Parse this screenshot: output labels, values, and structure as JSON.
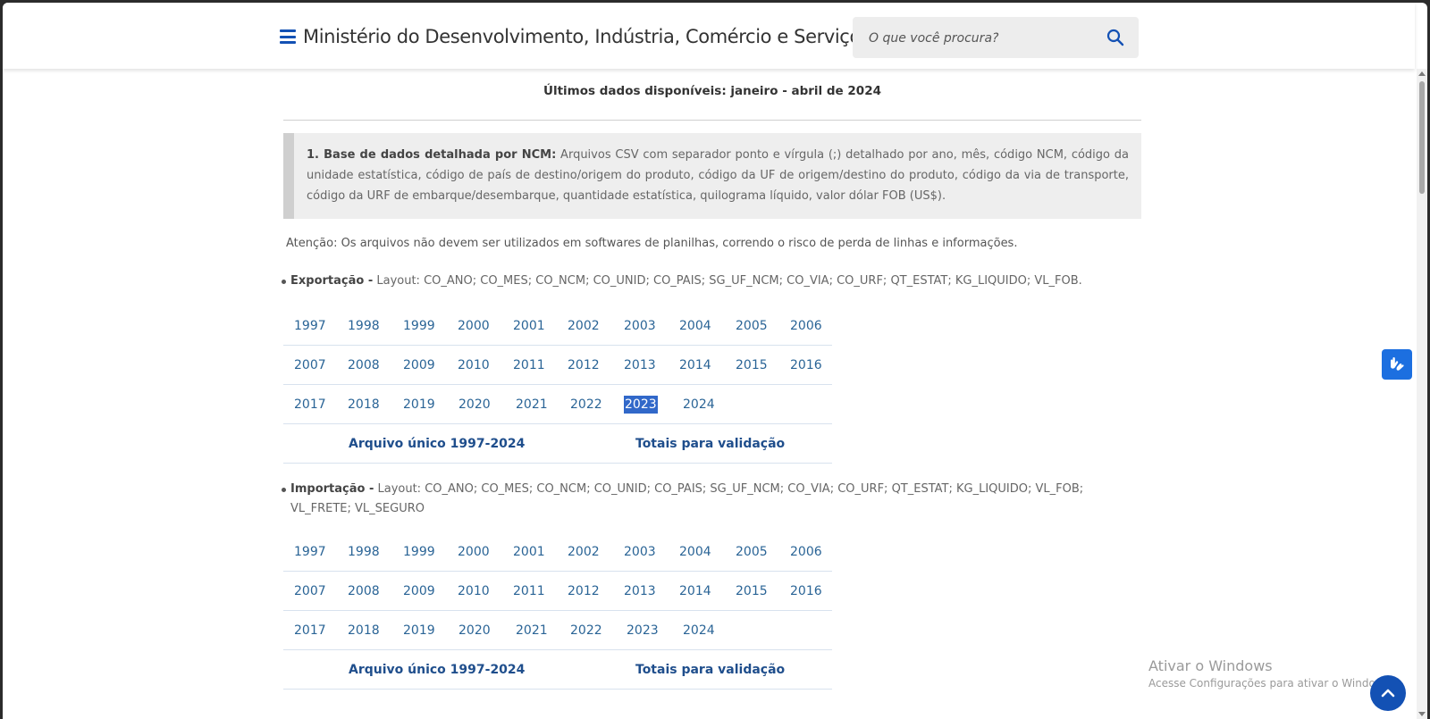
{
  "header": {
    "title": "Ministério do Desenvolvimento, Indústria, Comércio e Serviços",
    "search_placeholder": "O que você procura?"
  },
  "main": {
    "latest_data": "Últimos dados disponíveis: janeiro - abril de 2024",
    "note": {
      "heading": "1. Base de dados detalhada por NCM:",
      "text": " Arquivos CSV com separador ponto e vírgula (;) detalhado por ano, mês, código NCM, código da unidade estatística, código de país de destino/origem do produto, código da UF de origem/destino do produto, código da via de transporte, código da URF de embarque/desembarque, quantidade estatística, quilograma líquido, valor dólar FOB (US$)."
    },
    "attention": "Atenção: Os arquivos não devem ser utilizados em softwares de planilhas, correndo o risco de perda de linhas e informações.",
    "export": {
      "label": "Exportação -",
      "layout": " Layout: CO_ANO; CO_MES; CO_NCM; CO_UNID; CO_PAIS; SG_UF_NCM; CO_VIA; CO_URF; QT_ESTAT; KG_LIQUIDO; VL_FOB.",
      "years_row1": [
        "1997",
        "1998",
        "1999",
        "2000",
        "2001",
        "2002",
        "2003",
        "2004",
        "2005",
        "2006"
      ],
      "years_row2": [
        "2007",
        "2008",
        "2009",
        "2010",
        "2011",
        "2012",
        "2013",
        "2014",
        "2015",
        "2016"
      ],
      "years_row3": [
        "2017",
        "2018",
        "2019",
        "2020",
        "2021",
        "2022",
        "2023",
        "2024"
      ],
      "selected_year": "2023",
      "single_file": "Arquivo único 1997-2024",
      "totals": "Totais para validação"
    },
    "import": {
      "label": "Importação -",
      "layout": " Layout: CO_ANO; CO_MES; CO_NCM; CO_UNID; CO_PAIS; SG_UF_NCM; CO_VIA; CO_URF; QT_ESTAT; KG_LIQUIDO; VL_FOB; VL_FRETE; VL_SEGURO",
      "years_row1": [
        "1997",
        "1998",
        "1999",
        "2000",
        "2001",
        "2002",
        "2003",
        "2004",
        "2005",
        "2006"
      ],
      "years_row2": [
        "2007",
        "2008",
        "2009",
        "2010",
        "2011",
        "2012",
        "2013",
        "2014",
        "2015",
        "2016"
      ],
      "years_row3": [
        "2017",
        "2018",
        "2019",
        "2020",
        "2021",
        "2022",
        "2023",
        "2024"
      ],
      "single_file": "Arquivo único 1997-2024",
      "totals": "Totais para validação"
    }
  },
  "overlay": {
    "watermark_title": "Ativar o Windows",
    "watermark_sub": "Acesse Configurações para ativar o Windows."
  },
  "colors": {
    "accent": "#1351b4",
    "link": "#2a6496",
    "selected_bg": "#3168c9"
  }
}
